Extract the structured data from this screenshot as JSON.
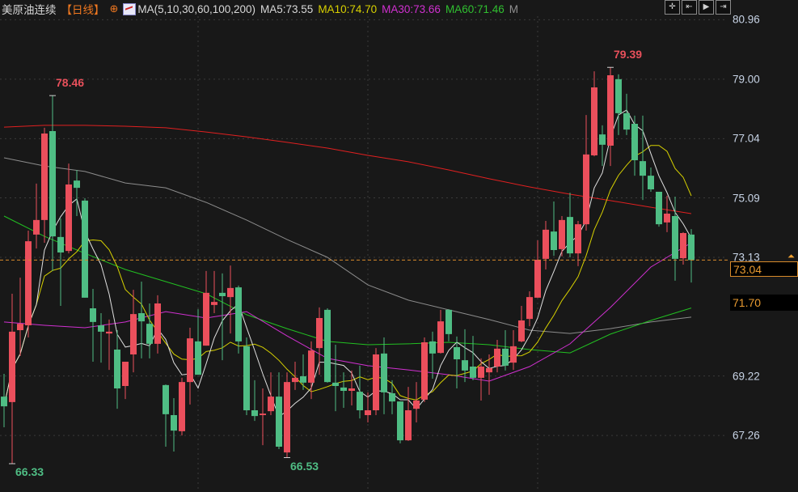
{
  "header": {
    "symbol": "美原油连续",
    "period": "【日线】",
    "ma_params": "MA(5,10,30,60,100,200)",
    "ma5": "MA5:73.55",
    "ma10": "MA10:74.70",
    "ma30": "MA30:73.66",
    "ma60": "MA60:71.46",
    "ma_more": "M"
  },
  "toolbar": {
    "tools": [
      "crosshair-tool",
      "zoom-to-start-tool",
      "play-tool",
      "exit-tool"
    ]
  },
  "axis": {
    "ticks": [
      "80.96",
      "79.00",
      "77.04",
      "75.09",
      "73.13",
      "69.22",
      "67.26"
    ],
    "current_price": "73.04",
    "ma_label": "71.70"
  },
  "annotations": {
    "high1": "78.46",
    "low1": "66.33",
    "low2": "66.53",
    "high2": "79.39"
  },
  "colors": {
    "up": "#eb4f5c",
    "down": "#4fbd84",
    "ma5": "#e0e0e0",
    "ma10": "#d6d000",
    "ma30": "#d030d0",
    "ma60": "#22c022",
    "ma100": "#8c8c8c",
    "ma200": "#e02020",
    "current": "#e89a30"
  },
  "chart_data": {
    "type": "candlestick",
    "ylim": [
      65.9,
      81.3
    ],
    "ohlc": [
      [
        68.54,
        69.29,
        67.53,
        68.22
      ],
      [
        68.36,
        71.93,
        66.33,
        70.68
      ],
      [
        70.73,
        72.46,
        69.88,
        70.94
      ],
      [
        70.89,
        74.01,
        70.49,
        73.66
      ],
      [
        73.88,
        75.56,
        73.42,
        74.36
      ],
      [
        74.36,
        77.4,
        73.61,
        77.21
      ],
      [
        77.29,
        78.46,
        72.68,
        73.82
      ],
      [
        73.8,
        74.41,
        71.53,
        73.29
      ],
      [
        73.34,
        76.22,
        73.26,
        75.53
      ],
      [
        75.66,
        76.01,
        74.49,
        75.42
      ],
      [
        75.0,
        75.08,
        71.8,
        71.8
      ],
      [
        71.45,
        72.09,
        69.69,
        71.0
      ],
      [
        70.89,
        71.29,
        69.66,
        70.68
      ],
      [
        70.62,
        71.08,
        69.42,
        70.68
      ],
      [
        70.09,
        70.73,
        68.14,
        68.81
      ],
      [
        68.89,
        69.69,
        68.46,
        69.69
      ],
      [
        69.93,
        72.06,
        69.34,
        71.26
      ],
      [
        71.29,
        72.33,
        69.8,
        71.02
      ],
      [
        70.94,
        71.61,
        69.8,
        70.28
      ],
      [
        70.28,
        71.88,
        69.96,
        71.61
      ],
      [
        68.92,
        68.94,
        66.89,
        67.96
      ],
      [
        67.93,
        68.49,
        66.73,
        67.42
      ],
      [
        67.4,
        69.16,
        67.26,
        69.02
      ],
      [
        69.02,
        70.81,
        68.28,
        70.46
      ],
      [
        70.36,
        71.42,
        69.26,
        69.26
      ],
      [
        70.22,
        72.68,
        70.22,
        71.96
      ],
      [
        71.56,
        72.68,
        71.29,
        71.66
      ],
      [
        71.96,
        72.6,
        69.74,
        71.85
      ],
      [
        71.82,
        72.86,
        70.62,
        72.12
      ],
      [
        72.14,
        72.2,
        69.96,
        70.36
      ],
      [
        70.2,
        70.49,
        67.93,
        68.09
      ],
      [
        68.09,
        69.08,
        67.74,
        67.9
      ],
      [
        67.93,
        68.81,
        66.94,
        67.98
      ],
      [
        68.06,
        69.34,
        67.93,
        68.54
      ],
      [
        68.54,
        69.34,
        66.81,
        66.89
      ],
      [
        66.7,
        69.34,
        66.53,
        69.02
      ],
      [
        69.02,
        69.69,
        68.76,
        69.16
      ],
      [
        69.21,
        69.93,
        68.76,
        69.0
      ],
      [
        69.0,
        70.36,
        68.46,
        70.06
      ],
      [
        70.14,
        71.48,
        69.26,
        71.13
      ],
      [
        71.4,
        71.45,
        69.0,
        69.02
      ],
      [
        69.0,
        70.25,
        68.06,
        68.89
      ],
      [
        68.84,
        69.34,
        68.17,
        68.73
      ],
      [
        68.73,
        69.4,
        68.25,
        68.81
      ],
      [
        68.7,
        69.56,
        67.82,
        68.09
      ],
      [
        67.93,
        68.68,
        67.69,
        68.09
      ],
      [
        68.09,
        70.14,
        67.93,
        69.93
      ],
      [
        69.96,
        70.49,
        67.96,
        68.68
      ],
      [
        68.65,
        69.08,
        67.96,
        68.38
      ],
      [
        68.38,
        68.38,
        67.0,
        67.1
      ],
      [
        67.1,
        68.86,
        67.08,
        68.09
      ],
      [
        68.14,
        69.02,
        67.69,
        68.41
      ],
      [
        68.44,
        70.49,
        68.36,
        70.33
      ],
      [
        70.36,
        70.68,
        69.13,
        69.96
      ],
      [
        69.98,
        71.4,
        69.96,
        71.02
      ],
      [
        71.4,
        71.42,
        70.36,
        70.6
      ],
      [
        70.17,
        70.52,
        68.81,
        69.77
      ],
      [
        69.74,
        70.76,
        69.02,
        69.4
      ],
      [
        69.53,
        70.54,
        69.08,
        69.16
      ],
      [
        69.16,
        69.8,
        68.41,
        69.53
      ],
      [
        69.34,
        69.93,
        68.6,
        69.48
      ],
      [
        69.53,
        70.41,
        69.34,
        70.12
      ],
      [
        70.12,
        70.73,
        69.4,
        69.56
      ],
      [
        69.66,
        70.73,
        69.42,
        70.2
      ],
      [
        70.36,
        71.53,
        70.33,
        71.05
      ],
      [
        71.1,
        72.01,
        70.86,
        71.82
      ],
      [
        71.8,
        73.69,
        71.8,
        73.05
      ],
      [
        73.08,
        74.33,
        72.73,
        74.04
      ],
      [
        73.98,
        74.97,
        73.18,
        73.37
      ],
      [
        73.4,
        74.49,
        73.16,
        74.36
      ],
      [
        74.46,
        75.26,
        73.13,
        73.26
      ],
      [
        73.26,
        74.33,
        72.84,
        74.22
      ],
      [
        74.22,
        77.82,
        74.01,
        76.52
      ],
      [
        76.49,
        79.26,
        76.46,
        78.73
      ],
      [
        77.18,
        77.48,
        76.14,
        76.84
      ],
      [
        76.81,
        79.39,
        76.14,
        79.13
      ],
      [
        79.0,
        79.16,
        77.16,
        77.88
      ],
      [
        77.88,
        78.52,
        77.16,
        77.34
      ],
      [
        77.53,
        77.8,
        75.82,
        76.33
      ],
      [
        76.3,
        77.8,
        75.02,
        75.82
      ],
      [
        75.82,
        76.09,
        75.29,
        75.37
      ],
      [
        75.29,
        75.29,
        74.14,
        74.22
      ],
      [
        74.28,
        75.16,
        73.96,
        74.57
      ],
      [
        74.49,
        75.13,
        72.36,
        73.08
      ],
      [
        73.1,
        73.96,
        72.89,
        73.93
      ],
      [
        73.88,
        74.06,
        72.3,
        73.04
      ]
    ],
    "ma_sample_step": 5,
    "ma30": [
      71.0,
      70.89,
      70.81,
      71.0,
      71.34,
      71.13,
      71.34,
      70.54,
      69.8,
      69.56,
      69.42,
      69.26,
      69.05,
      69.53,
      70.28,
      71.48,
      72.81,
      73.61
    ],
    "ma60": [
      74.49,
      73.82,
      73.26,
      72.73,
      72.33,
      71.93,
      71.24,
      70.78,
      70.36,
      70.25,
      70.28,
      70.33,
      70.25,
      70.09,
      69.98,
      70.6,
      71.05,
      71.46
    ],
    "ma100": [
      76.41,
      76.14,
      75.96,
      75.58,
      75.42,
      74.94,
      74.36,
      73.72,
      73.13,
      72.22,
      71.72,
      71.4,
      71.08,
      70.73,
      70.62,
      70.78,
      71.0,
      71.16
    ],
    "ma200": [
      77.42,
      77.48,
      77.48,
      77.45,
      77.4,
      77.26,
      77.1,
      76.92,
      76.73,
      76.49,
      76.28,
      76.01,
      75.72,
      75.45,
      75.21,
      75.0,
      74.78,
      74.57
    ]
  }
}
